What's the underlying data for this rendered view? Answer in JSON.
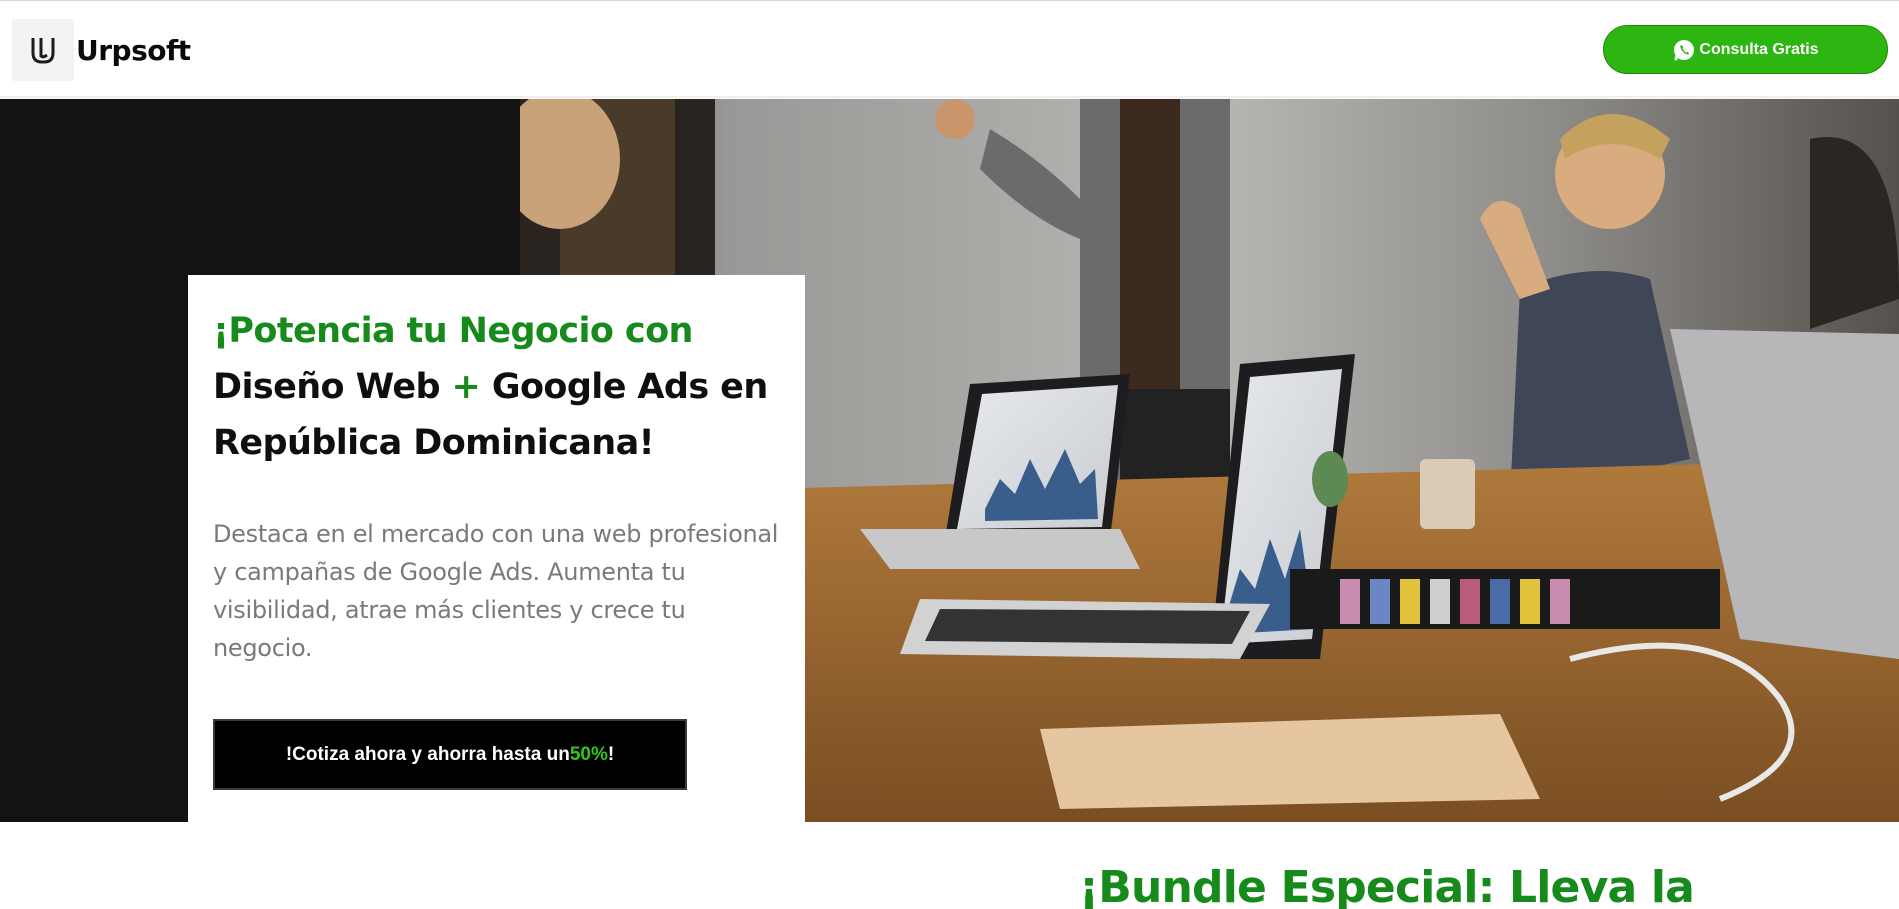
{
  "brand": {
    "name": "Urpsoft",
    "logo_icon": "urpsoft-u-icon"
  },
  "header": {
    "cta_label": "Consulta Gratis",
    "cta_icon": "whatsapp-icon",
    "cta_color": "#2db511"
  },
  "hero": {
    "headline_part1": "¡Potencia tu Negocio con",
    "headline_part2": "Diseño Web ",
    "headline_plus": "+",
    "headline_part3": " Google Ads en República Dominicana!",
    "description": "Destaca en el mercado con una web profesional y campañas de Google Ads. Aumenta tu visibilidad, atrae más clientes y crece tu negocio.",
    "cta_prefix": "!Cotiza ahora y ahorra hasta un ",
    "cta_percent": "50%",
    "cta_suffix": "!",
    "image_alt": "team-meeting-photo",
    "accent_green": "#178a1c"
  },
  "section": {
    "title": "¡Bundle Especial: Lleva la"
  }
}
